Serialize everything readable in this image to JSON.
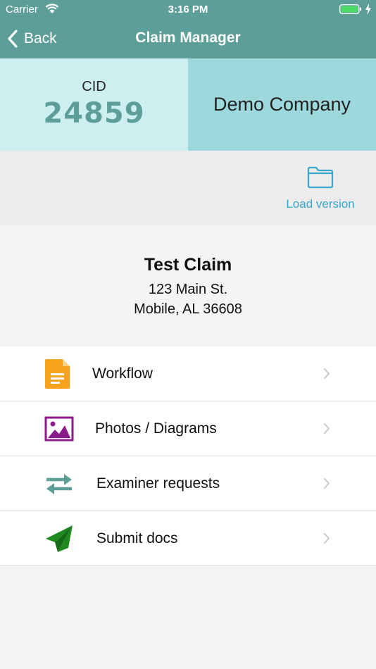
{
  "status_bar": {
    "carrier": "Carrier",
    "time": "3:16 PM"
  },
  "nav": {
    "back_label": "Back",
    "title": "Claim Manager"
  },
  "cid": {
    "label": "CID",
    "value": "24859"
  },
  "company": {
    "name": "Demo Company"
  },
  "load_version": {
    "label": "Load version",
    "icon": "folder-icon"
  },
  "claim": {
    "title": "Test Claim",
    "address_line1": "123 Main St.",
    "address_line2": "Mobile, AL 36608"
  },
  "menu": [
    {
      "label": "Workflow",
      "icon": "document-icon",
      "color": "#f7a21b"
    },
    {
      "label": "Photos / Diagrams",
      "icon": "image-icon",
      "color": "#8b1a8b"
    },
    {
      "label": "Examiner requests",
      "icon": "swap-arrows-icon",
      "color": "#5e9e98"
    },
    {
      "label": "Submit docs",
      "icon": "paper-plane-icon",
      "color": "#1e8a1e"
    }
  ],
  "colors": {
    "header": "#5e9e98",
    "cid_bg": "#cdeff0",
    "company_bg": "#9dd8dc",
    "link": "#3aa6c9",
    "battery": "#4cd964"
  }
}
